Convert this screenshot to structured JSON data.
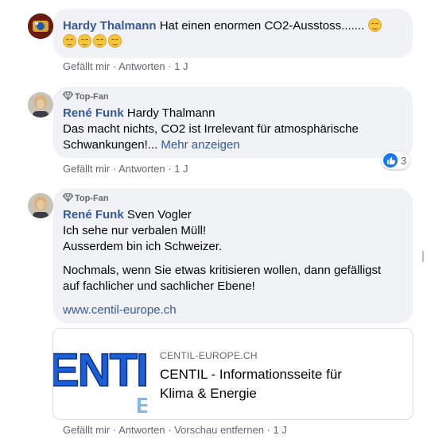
{
  "comments": [
    {
      "author": "Hardy Thalmann",
      "text_line1": " Hat einen enormen CO2-Ausstoss.......",
      "actions": {
        "like": "Gefällt mir",
        "reply": "Antworten",
        "time": "1 J"
      }
    },
    {
      "badge": "Top-Fan",
      "author": "René Funk",
      "mention": " Hardy Thalmann",
      "line2": "Das macht nichts, CO2 ist Irrelevant für atmosphärische",
      "line3": "Schwankungen!...",
      "more": " Mehr anzeigen",
      "reactions": "3",
      "actions": {
        "like": "Gefällt mir",
        "reply": "Antworten",
        "time": "1 J"
      }
    },
    {
      "badge": "Top-Fan",
      "author": "René Funk",
      "mention": " Sven Vogler",
      "line2": "Ich sehe nur verbalen Müll!",
      "line3": "Ausserdem bin ich Schweizer.",
      "line4": "Nochmals, wenn Sie etwas kritisieren wollen, dann gefälligst",
      "line5": "auf fachlicher und sachlicher Ebene!",
      "link": "www.centil-europe.ch",
      "preview": {
        "image_text_1": "ENTI",
        "image_text_2": "E",
        "domain": "CENTIL-EUROPE.CH",
        "title_line1": "CENTIL - Informationsseite für",
        "title_line2": "Klima & Energie"
      },
      "actions": {
        "like": "Gefällt mir",
        "reply": "Antworten",
        "remove_preview": "Vorschau entfernen",
        "time": "1 J"
      }
    }
  ],
  "separator": " · ",
  "colors": {
    "author": "#385898",
    "bubble": "#f0f2f5",
    "meta": "#65676b",
    "like_blue": "#1877f2"
  },
  "icons": {
    "emoji": "grinning-squinting-face-icon",
    "badge": "diamond-icon",
    "reaction": "thumbs-up-icon"
  }
}
